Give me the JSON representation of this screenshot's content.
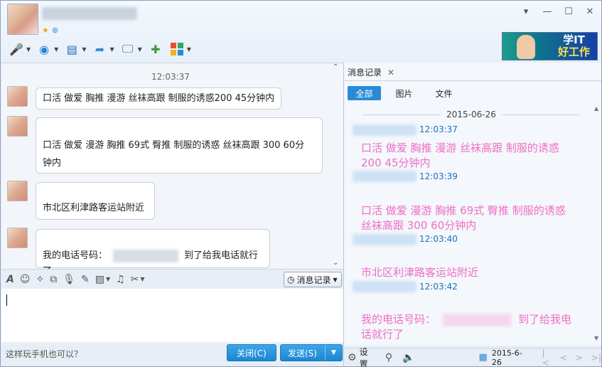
{
  "window": {
    "controls": {
      "dropdown": "▾",
      "minimize": "—",
      "maximize": "☐",
      "close": "✕"
    }
  },
  "toolbar": {
    "items": [
      {
        "icon": "microphone-icon",
        "glyph": "🎤"
      },
      {
        "icon": "video-camera-icon",
        "glyph": "◉"
      },
      {
        "icon": "screen-share-icon",
        "glyph": "▤"
      },
      {
        "icon": "file-transfer-icon",
        "glyph": "📁"
      },
      {
        "icon": "remote-desktop-icon",
        "glyph": "🖥"
      },
      {
        "icon": "add-chat-icon",
        "glyph": "💬"
      },
      {
        "icon": "apps-icon",
        "glyph": "▦"
      }
    ]
  },
  "ad": {
    "line1": "学IT",
    "line2": "好工作"
  },
  "chat": {
    "timestamp": "12:03:37",
    "messages": [
      {
        "text": "口活  做爱  胸推  漫游 丝袜高跟  制服的诱惑200  45分钟内"
      },
      {
        "line1": "口活  做爱  漫游 胸推  69式  臀推  制服的诱惑  丝袜高跟 300  60分",
        "line2": "钟内"
      },
      {
        "text": "市北区利津路客运站附近"
      },
      {
        "prefix": "我的电话号码：",
        "suffix": "到了给我电话就行了"
      }
    ]
  },
  "input_toolbar": {
    "history_button": "消息记录",
    "icons": [
      "font-icon",
      "emoji-icon",
      "nudge-icon",
      "screenshot-icon",
      "voice-icon",
      "edit-icon",
      "image-icon",
      "music-icon",
      "scissors-icon"
    ]
  },
  "bottom": {
    "tip": "这样玩手机也可以？",
    "close_label": "关闭(C)",
    "send_label": "发送(S)"
  },
  "history_panel": {
    "tab_label": "消息记录",
    "filters": [
      "全部",
      "图片",
      "文件"
    ],
    "active_filter": "全部",
    "date": "2015-06-26",
    "entries": [
      {
        "time": "12:03:37",
        "text": "口活  做爱  胸推  漫游 丝袜高跟  制服的诱惑200  45分钟内"
      },
      {
        "time": "12:03:39",
        "text": "口活 做爱 漫游 胸推  69式  臀推 制服的诱惑  丝袜高跟 300  60分钟内"
      },
      {
        "time": "12:03:40",
        "text": "市北区利津路客运站附近"
      },
      {
        "time": "12:03:42",
        "prefix": "我的电话号码：",
        "suffix": "到了给我电话就行了"
      }
    ],
    "colors": {
      "time": "#1a70c2",
      "text": "#ee6fc6"
    },
    "footer": {
      "settings_label": "设置",
      "date_label": "2015-6-26"
    }
  }
}
